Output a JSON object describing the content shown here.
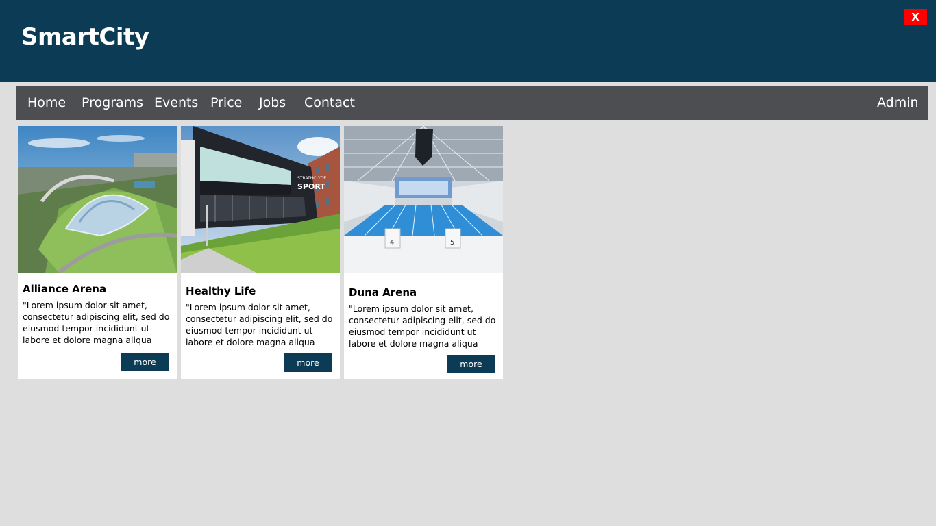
{
  "app": {
    "title": "SmartCity",
    "close_label": "X"
  },
  "nav": {
    "items": [
      "Home",
      "Programs",
      "Events",
      "Price",
      "Jobs",
      "Contact"
    ],
    "admin": "Admin"
  },
  "cards": [
    {
      "title": "Alliance Arena",
      "description": "\"Lorem ipsum dolor sit amet, consectetur adipiscing elit, sed do eiusmod tempor incididunt ut labore et dolore magna aliqua",
      "button": "more",
      "image": "stadium-aerial-photo"
    },
    {
      "title": "Healthy Life",
      "description": "\"Lorem ipsum dolor sit amet, consectetur adipiscing elit, sed do eiusmod tempor incididunt ut labore et dolore magna aliqua",
      "button": "more",
      "image": "sport-building-photo",
      "sign_lines": [
        "STRATHCLYDE",
        "SPORT"
      ]
    },
    {
      "title": "Duna Arena",
      "description": "\"Lorem ipsum dolor sit amet, consectetur adipiscing elit, sed do eiusmod tempor incididunt ut labore et dolore magna aliqua",
      "button": "more",
      "image": "swimming-pool-photo",
      "block_numbers": [
        "4",
        "5"
      ]
    }
  ],
  "colors": {
    "header": "#0b3b55",
    "nav": "#4d4e52",
    "background": "#dedede",
    "close": "#ff0000",
    "button": "#0b3b55"
  }
}
